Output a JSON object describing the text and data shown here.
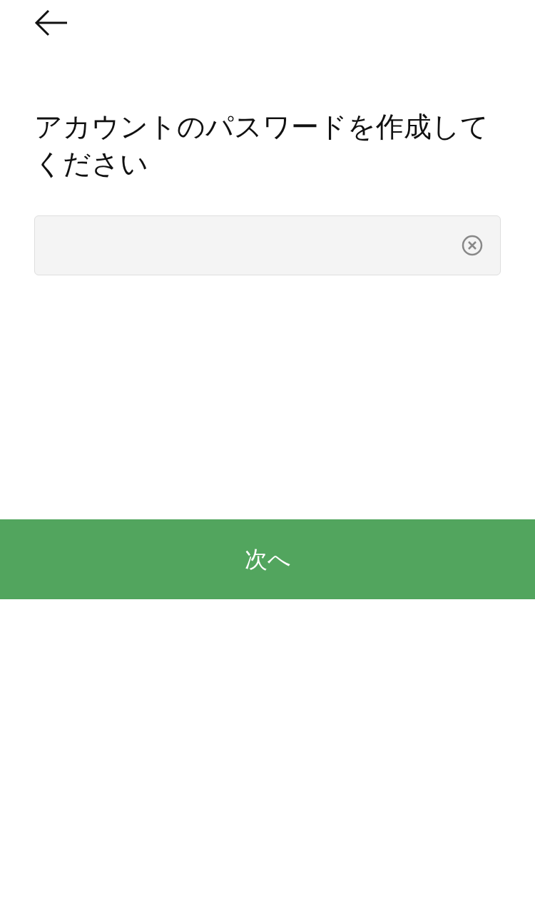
{
  "title": "アカウントのパスワードを作成してください",
  "next_button": {
    "label": "次へ"
  }
}
